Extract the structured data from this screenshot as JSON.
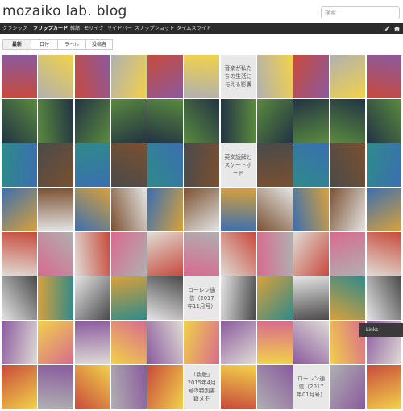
{
  "header": {
    "title": "mozaiko lab. blog",
    "search_placeholder": "検索"
  },
  "nav": {
    "items": [
      "クラシック",
      "フリップカード",
      "雑誌",
      "モザイク",
      "サイドバー",
      "スナップショット",
      "タイムスライド"
    ],
    "active": 1,
    "icons": [
      "pencil-icon",
      "home-icon"
    ]
  },
  "tabs": {
    "items": [
      "最新",
      "日付",
      "ラベル",
      "投稿者"
    ],
    "active": 0
  },
  "tiles": [
    "",
    "",
    "",
    "",
    "",
    "",
    "",
    "",
    "",
    "",
    "",
    "",
    "",
    "",
    "",
    "",
    "",
    "",
    "",
    "",
    "",
    "",
    "",
    "",
    "",
    "",
    "",
    "",
    "英文読解とスケートボード",
    "",
    "",
    "",
    "",
    "",
    "",
    "",
    "",
    "",
    "",
    "",
    "",
    "",
    "",
    "",
    "",
    "",
    "",
    "",
    "",
    "",
    "",
    "",
    "",
    "",
    "",
    "",
    "",
    "",
    "",
    "",
    "ローレン通信（2017年11月号）",
    "",
    "",
    "",
    "",
    "",
    "",
    "",
    "",
    "",
    "",
    "",
    "",
    "",
    "",
    "",
    "",
    "",
    "",
    "",
    "",
    "",
    "「新版」2015年4月号の特別書籍メモ",
    "",
    "",
    "ローレン通信（2017年01月号）",
    "",
    ""
  ],
  "special_tiles": {
    "music_post": "音楽が私たちの生活に与える影響"
  },
  "colors": {
    "navbar": "#2b2b2b",
    "tile_palette": [
      "#c84a3c",
      "#d9a13b",
      "#3a6fb0",
      "#5a8a3e",
      "#8a5a9e",
      "#d86a8e",
      "#2f8a8a",
      "#b0b0b0",
      "#e5e5e5",
      "#7a5030",
      "#223344",
      "#f2d24a",
      "#e0dcd5",
      "#4a4a4a"
    ]
  },
  "links_panel": {
    "label": "Links"
  }
}
